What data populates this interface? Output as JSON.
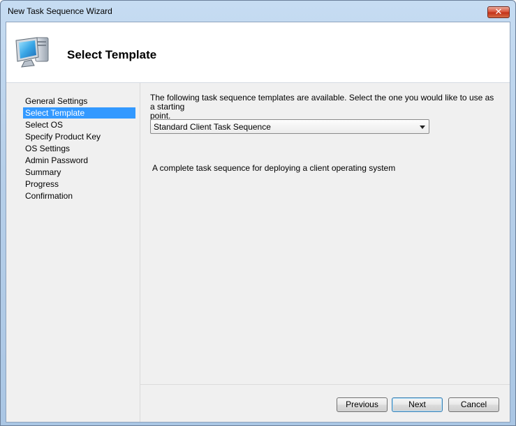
{
  "window": {
    "title": "New Task Sequence Wizard",
    "close_glyph": "✕"
  },
  "header": {
    "title": "Select Template",
    "icon": "computer-icon"
  },
  "nav": {
    "items": [
      {
        "label": "General Settings",
        "selected": false
      },
      {
        "label": "Select Template",
        "selected": true
      },
      {
        "label": "Select OS",
        "selected": false
      },
      {
        "label": "Specify Product Key",
        "selected": false
      },
      {
        "label": "OS Settings",
        "selected": false
      },
      {
        "label": "Admin Password",
        "selected": false
      },
      {
        "label": "Summary",
        "selected": false
      },
      {
        "label": "Progress",
        "selected": false
      },
      {
        "label": "Confirmation",
        "selected": false
      }
    ],
    "selected_color": "#3399ff"
  },
  "main": {
    "description_line1": "The following task sequence templates are available.  Select the one you would like to use as a starting",
    "description_line2": "point.",
    "template_select": {
      "value": "Standard Client Task Sequence"
    },
    "template_description": "A complete task sequence for deploying a client operating system"
  },
  "footer": {
    "previous_label": "Previous",
    "next_label": "Next",
    "cancel_label": "Cancel"
  }
}
